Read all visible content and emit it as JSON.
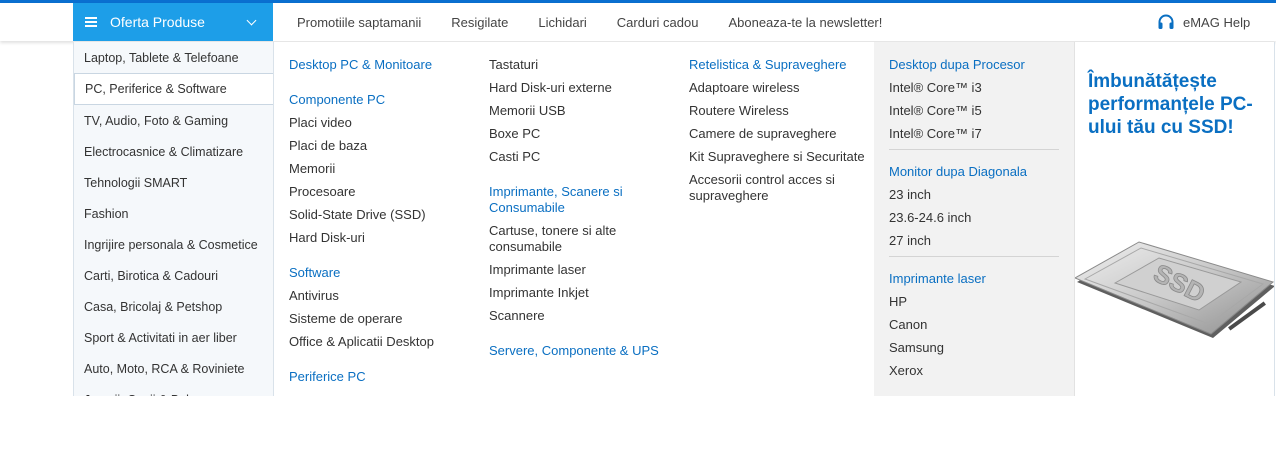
{
  "header": {
    "oferta_label": "Oferta Produse",
    "nav": [
      "Promotiile saptamanii",
      "Resigilate",
      "Lichidari",
      "Carduri cadou",
      "Aboneaza-te la newsletter!"
    ],
    "help_label": "eMAG Help"
  },
  "sidebar": {
    "items": [
      {
        "label": "Laptop, Tablete & Telefoane"
      },
      {
        "label": "PC, Periferice & Software"
      },
      {
        "label": "TV, Audio, Foto & Gaming"
      },
      {
        "label": "Electrocasnice & Climatizare"
      },
      {
        "label": "Tehnologii SMART"
      },
      {
        "label": "Fashion"
      },
      {
        "label": "Ingrijire personala & Cosmetice"
      },
      {
        "label": "Carti, Birotica & Cadouri"
      },
      {
        "label": "Casa, Bricolaj & Petshop"
      },
      {
        "label": "Sport & Activitati in aer liber"
      },
      {
        "label": "Auto, Moto, RCA & Roviniete"
      },
      {
        "label": "Jucarii, Copii & Bebe"
      }
    ],
    "active_index": 1
  },
  "menu": {
    "col1": {
      "desktop_heading": "Desktop PC & Monitoare",
      "componente_heading": "Componente PC",
      "componente_items": [
        "Placi video",
        "Placi de baza",
        "Memorii",
        "Procesoare",
        "Solid-State Drive (SSD)",
        "Hard Disk-uri"
      ],
      "software_heading": "Software",
      "software_items": [
        "Antivirus",
        "Sisteme de operare",
        "Office & Aplicatii Desktop"
      ],
      "periferice_heading": "Periferice PC"
    },
    "col2": {
      "items_top": [
        "Tastaturi",
        "Hard Disk-uri externe",
        "Memorii USB",
        "Boxe PC",
        "Casti PC"
      ],
      "imprimante_heading": "Imprimante, Scanere si Consumabile",
      "imprimante_items": [
        "Cartuse, tonere si alte consumabile",
        "Imprimante laser",
        "Imprimante Inkjet",
        "Scannere"
      ],
      "servere_heading": "Servere, Componente & UPS"
    },
    "col3": {
      "retelistica_heading": "Retelistica & Supraveghere",
      "retelistica_items": [
        "Adaptoare wireless",
        "Routere Wireless",
        "Camere de supraveghere",
        "Kit Supraveghere si Securitate",
        "Accesorii control acces si supraveghere"
      ]
    },
    "col4": {
      "procesor_heading": "Desktop dupa Procesor",
      "procesor_items": [
        "Intel® Core™ i3",
        "Intel® Core™ i5",
        "Intel® Core™ i7"
      ],
      "diagonala_heading": "Monitor dupa Diagonala",
      "diagonala_items": [
        "23 inch",
        "23.6-24.6 inch",
        "27 inch"
      ],
      "laser_heading": "Imprimante laser",
      "laser_items": [
        "HP",
        "Canon",
        "Samsung",
        "Xerox"
      ]
    }
  },
  "promo": {
    "title": "Îmbunătățește performanțele PC-ului tău cu SSD!",
    "ssd_label": "SSD",
    "accent_color": "#0a6fc2"
  }
}
